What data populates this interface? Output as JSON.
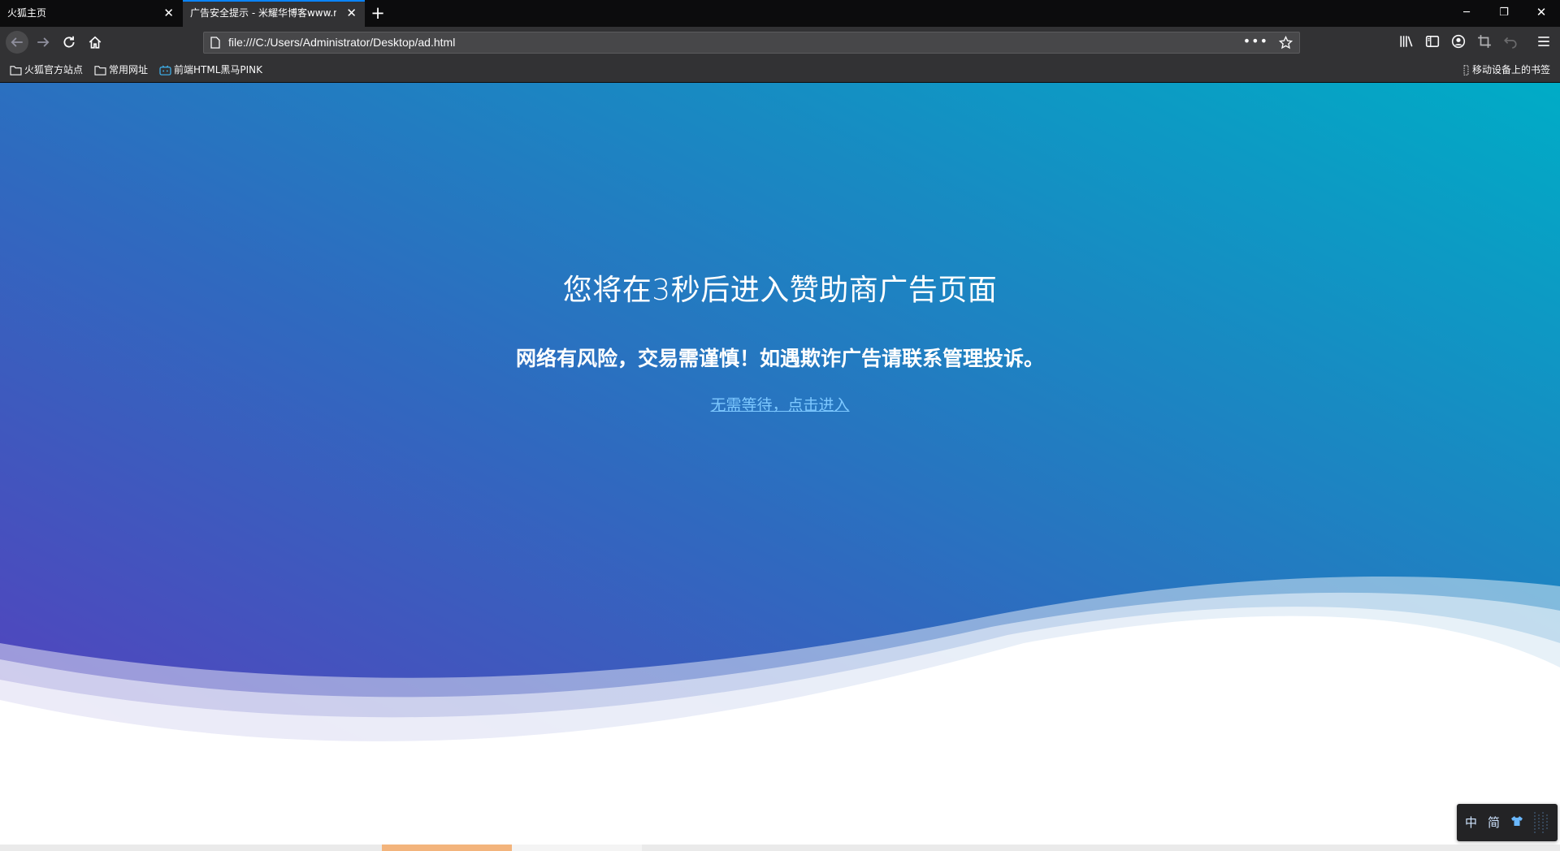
{
  "browser": {
    "tabs": [
      {
        "label": "火狐主页",
        "active": false
      },
      {
        "label": "广告安全提示 - 米耀华博客www.m",
        "active": true
      }
    ],
    "url": "file:///C:/Users/Administrator/Desktop/ad.html",
    "bookmarks": [
      {
        "label": "火狐官方站点",
        "icon": "folder-icon"
      },
      {
        "label": "常用网址",
        "icon": "folder-icon"
      },
      {
        "label": "前端HTML黑马PINK",
        "icon": "bilibili-icon"
      }
    ],
    "mobile_bookmarks": "移动设备上的书签",
    "accent": "#0a84ff"
  },
  "page": {
    "headline": "您将在3秒后进入赞助商广告页面",
    "subline": "网络有风险，交易需谨慎！如遇欺诈广告请联系管理投诉。",
    "enter_link": "无需等待，点击进入",
    "gradient": {
      "start": "#5a3bbd",
      "end": "#00acc6"
    }
  },
  "ime": {
    "lang": "中",
    "mode": "简",
    "skin_icon": "shirt-icon"
  }
}
